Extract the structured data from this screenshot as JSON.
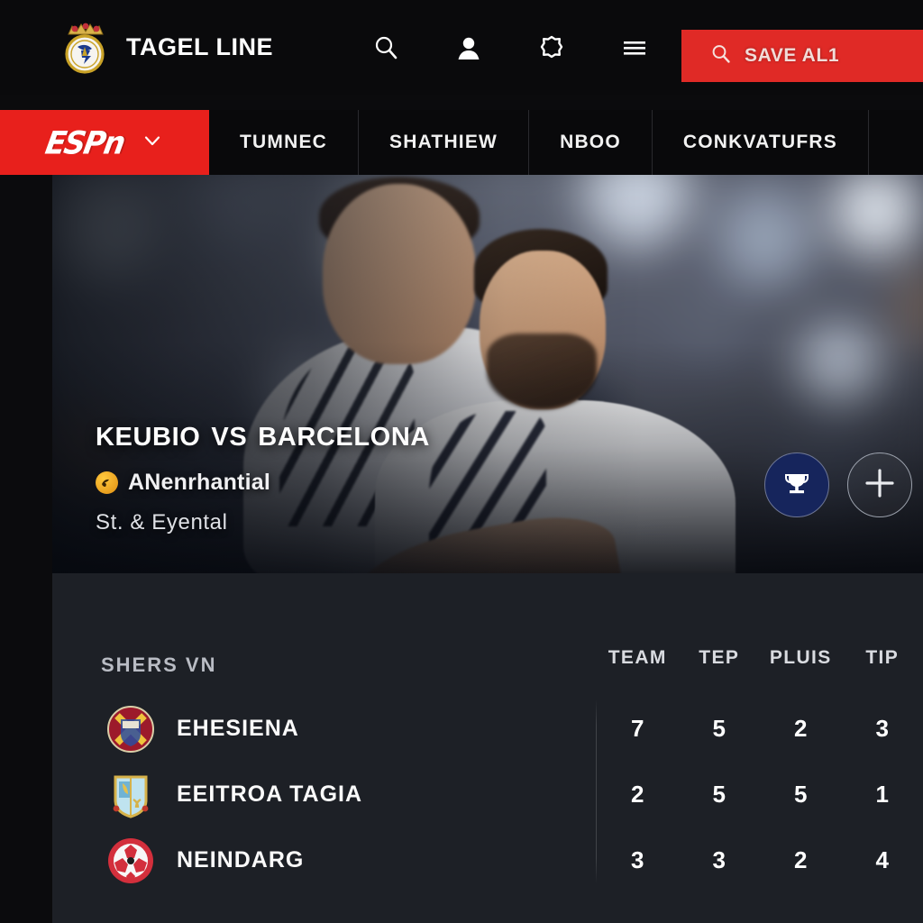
{
  "header": {
    "brand_title": "TAGEL LINE",
    "logo_icon": "real-madrid-crest-icon",
    "icons": [
      {
        "name": "search-icon"
      },
      {
        "name": "user-profile-icon"
      },
      {
        "name": "settings-gear-icon"
      },
      {
        "name": "hamburger-menu-icon"
      }
    ],
    "save_button": {
      "label": "SAVE AL1",
      "icon": "search-icon",
      "color": "#e02a26"
    }
  },
  "nav": {
    "logo_text": "ESPn",
    "dropdown_icon": "chevron-down-icon",
    "accent_color": "#e8201c",
    "items": [
      {
        "label": "TUMNEC"
      },
      {
        "label": "SHATHIEW"
      },
      {
        "label": "NBOO"
      },
      {
        "label": "CONKVATUFRS"
      }
    ]
  },
  "hero": {
    "title": "Keubio vs Barcelona",
    "badge_icon": "orange-swirl-badge-icon",
    "subtitle": "ANenrhantial",
    "meta": "St. & Eyental",
    "actions": [
      {
        "name": "trophy-button",
        "icon": "trophy-icon",
        "color": "#16255c"
      },
      {
        "name": "add-button",
        "icon": "plus-icon"
      }
    ]
  },
  "table": {
    "left_header": "SHERS VN",
    "stat_headers": [
      "TEAM",
      "TEP",
      "PLUIS",
      "TIP"
    ],
    "rows": [
      {
        "crest": "red-crest-icon",
        "name": "EHESIENA",
        "stats": [
          "7",
          "5",
          "2",
          "3"
        ]
      },
      {
        "crest": "blue-shield-crest-icon",
        "name": "EEITROA TAGIA",
        "stats": [
          "2",
          "5",
          "5",
          "1"
        ]
      },
      {
        "crest": "red-white-ball-icon",
        "name": "NEINDARG",
        "stats": [
          "3",
          "3",
          "2",
          "4"
        ]
      }
    ]
  }
}
